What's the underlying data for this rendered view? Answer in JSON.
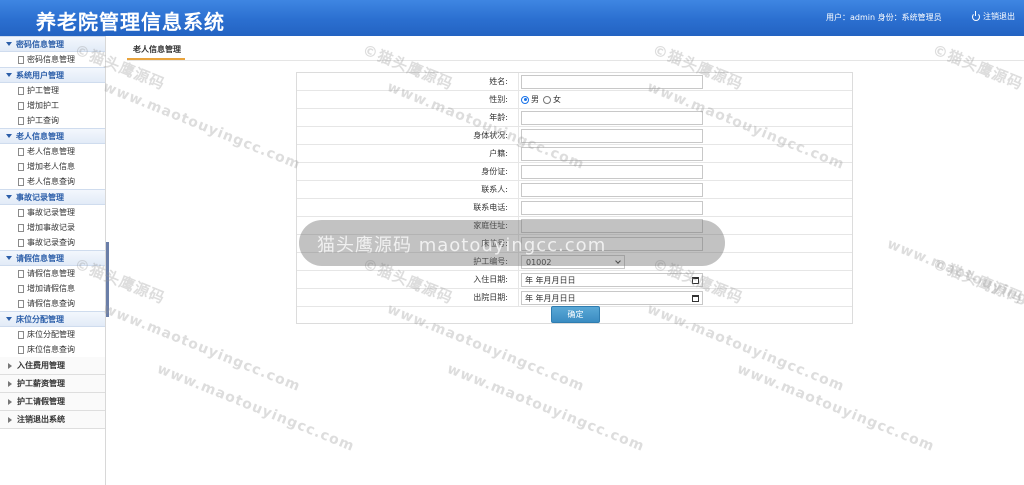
{
  "header": {
    "title": "养老院管理信息系统",
    "user_info": "用户：admin 身份：系统管理员",
    "logout": "注销退出"
  },
  "sidebar": {
    "groups": [
      {
        "title": "密码信息管理",
        "items": [
          "密码信息管理"
        ]
      },
      {
        "title": "系统用户管理",
        "items": [
          "护工管理",
          "增加护工",
          "护工查询"
        ]
      },
      {
        "title": "老人信息管理",
        "items": [
          "老人信息管理",
          "增加老人信息",
          "老人信息查询"
        ]
      },
      {
        "title": "事故记录管理",
        "items": [
          "事故记录管理",
          "增加事故记录",
          "事故记录查询"
        ]
      },
      {
        "title": "请假信息管理",
        "items": [
          "请假信息管理",
          "增加请假信息",
          "请假信息查询"
        ]
      },
      {
        "title": "床位分配管理",
        "items": [
          "床位分配管理",
          "床位信息查询"
        ]
      }
    ],
    "closed": [
      "入住费用管理",
      "护工薪资管理",
      "护工请假管理",
      "注销退出系统"
    ]
  },
  "tab": {
    "label": "老人信息管理"
  },
  "form": {
    "fields": {
      "name": {
        "label": "姓名:",
        "value": ""
      },
      "gender": {
        "label": "性别:",
        "male": "男",
        "female": "女"
      },
      "age": {
        "label": "年龄:",
        "value": ""
      },
      "health": {
        "label": "身体状况:",
        "value": ""
      },
      "hukou": {
        "label": "户籍:",
        "value": ""
      },
      "idcard": {
        "label": "身份证:",
        "value": ""
      },
      "contact": {
        "label": "联系人:",
        "value": ""
      },
      "phone": {
        "label": "联系电话:",
        "value": ""
      },
      "address": {
        "label": "家庭住址:",
        "value": ""
      },
      "bed": {
        "label": "床位号:",
        "value": ""
      },
      "nurse": {
        "label": "护工编号:",
        "value": "01002"
      },
      "checkin": {
        "label": "入住日期:",
        "value": "年 年月月日日"
      },
      "checkout": {
        "label": "出院日期:",
        "value": "年 年月月日日"
      }
    },
    "submit": "确定"
  },
  "watermark": {
    "cn": "©猫头鹰源码",
    "url": "www.maotouyingcc.com",
    "banner": "猫头鹰源码 maotouyingcc.com"
  }
}
